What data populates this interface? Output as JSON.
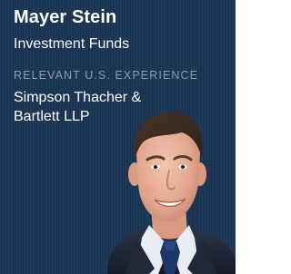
{
  "profile": {
    "name": "Mayer Stein",
    "practice": "Investment Funds",
    "experience_label": "RELEVANT U.S. EXPERIENCE",
    "firm_line1": "Simpson Thacher &",
    "firm_line2": "Bartlett LLP"
  },
  "colors": {
    "background": "#1a3553",
    "text": "#ffffff",
    "label": "#8c9bad"
  }
}
